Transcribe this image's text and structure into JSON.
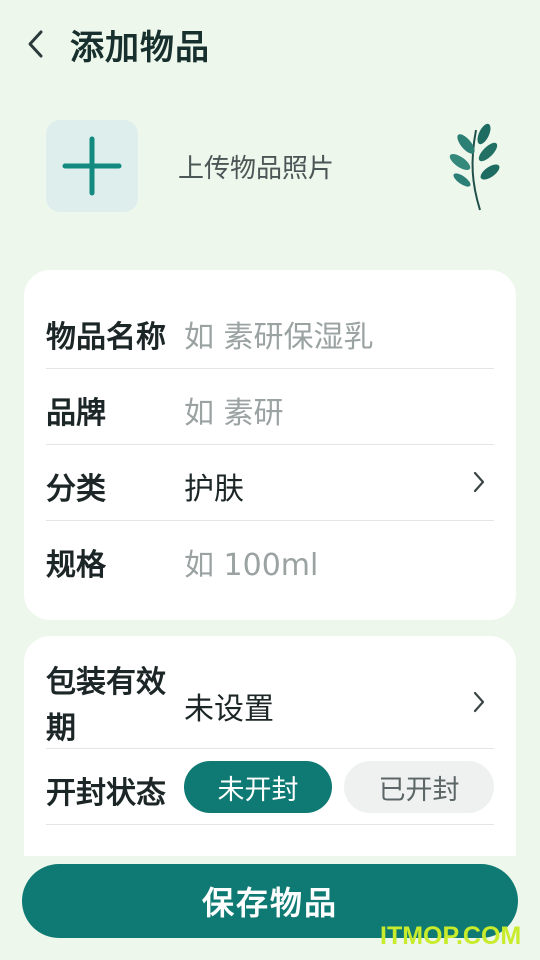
{
  "header": {
    "title": "添加物品"
  },
  "upload": {
    "label": "上传物品照片"
  },
  "form_basic": {
    "name": {
      "label": "物品名称",
      "placeholder": "如 素研保湿乳"
    },
    "brand": {
      "label": "品牌",
      "placeholder": "如 素研"
    },
    "category": {
      "label": "分类",
      "value": "护肤"
    },
    "spec": {
      "label": "规格",
      "placeholder": "如 100ml"
    }
  },
  "form_status": {
    "expiry": {
      "label": "包装有效期",
      "value": "未设置"
    },
    "opened": {
      "label": "开封状态",
      "options": [
        "未开封",
        "已开封"
      ],
      "selected": "未开封"
    }
  },
  "save_button": "保存物品",
  "watermark": "ITMOP.COM",
  "colors": {
    "accent": "#0f7a73",
    "background": "#eef7ec",
    "card": "#ffffff"
  }
}
